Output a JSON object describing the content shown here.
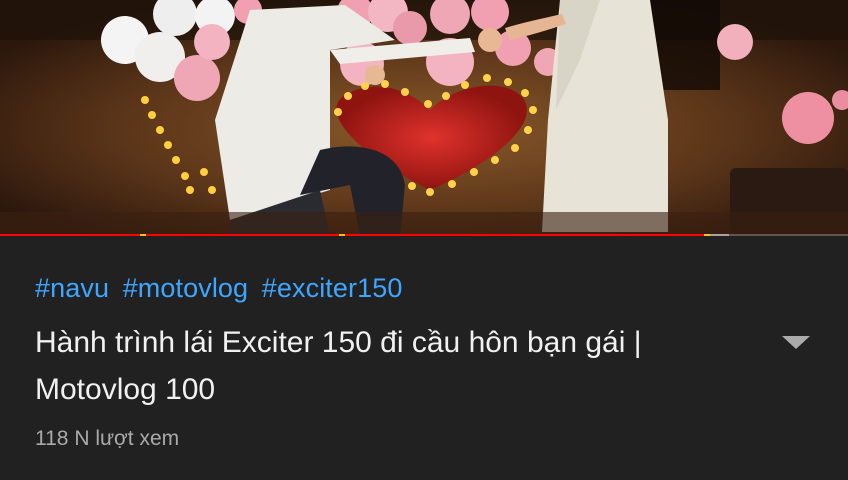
{
  "player": {
    "progress_fraction": 0.83,
    "buffered_fraction": 0.86,
    "played_color": "#ff0000",
    "ad_marker_color": "#f2c511",
    "ad_marker_fractions": [
      0.165,
      0.4,
      0.83
    ]
  },
  "video_info": {
    "hashtags": [
      "#navu",
      "#motovlog",
      "#exciter150"
    ],
    "hashtag_color": "#3ea6ff",
    "title": "Hành trình lái Exciter 150 đi cầu hôn bạn gái | Motovlog 100",
    "views": "118 N lượt xem",
    "expand_icon": "caret-down-icon"
  }
}
